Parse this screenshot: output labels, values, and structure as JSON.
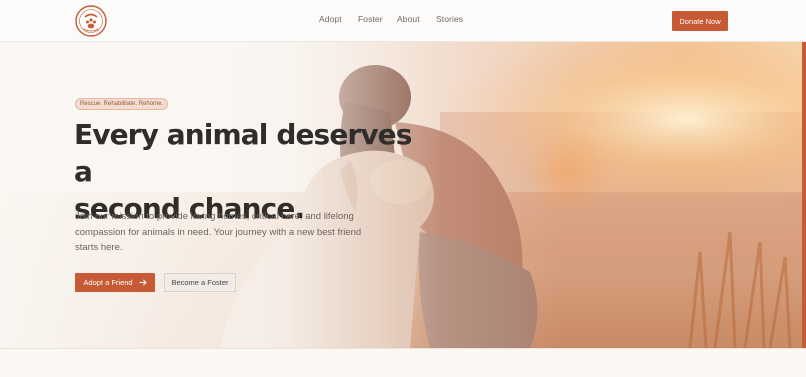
{
  "brand": {
    "logo_text_top": "SAFE HAVEN",
    "logo_text_bottom": "ANIMAL RESCUE"
  },
  "nav": {
    "items": [
      {
        "label": "Adopt"
      },
      {
        "label": "Foster"
      },
      {
        "label": "About"
      },
      {
        "label": "Stories"
      }
    ],
    "donate_label": "Donate Now"
  },
  "hero": {
    "tagline": "Rescue. Rehabilitate. Rehome.",
    "headline_line1": "Every animal deserves a",
    "headline_line2": "second chance.",
    "subtext": "Join our mission to provide loving homes, critical care, and lifelong compassion for animals in need. Your journey with a new best friend starts here.",
    "primary_cta": "Adopt a Friend",
    "primary_cta_icon": "arrow-right-icon",
    "secondary_cta": "Become a Foster",
    "image_subject": "woman-hugging-dog-photo"
  },
  "colors": {
    "accent": "#c65a35",
    "heading": "#2f2c29",
    "body_text": "#6a645f",
    "background": "#fbf8f4"
  }
}
